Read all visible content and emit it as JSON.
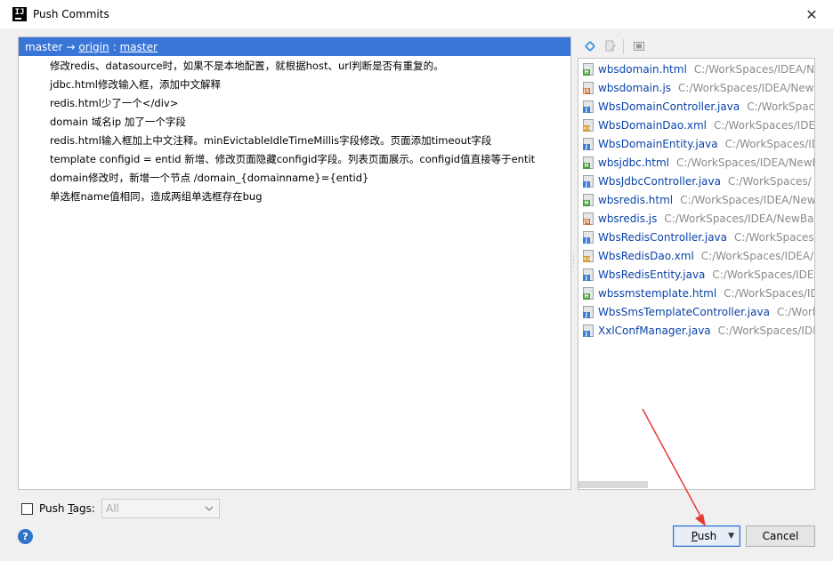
{
  "window": {
    "app_icon": "IJ",
    "title": "Push Commits",
    "close_glyph": "✕"
  },
  "commits": {
    "branch": {
      "local": "master",
      "arrow": "→",
      "remote": "origin",
      "separator": ":",
      "remote_branch": "master"
    },
    "items": [
      "修改redis、datasource时，如果不是本地配置，就根据host、url判断是否有重复的。",
      "jdbc.html修改输入框，添加中文解释",
      "redis.html少了一个</div>",
      "domain  域名ip  加了一个字段",
      "redis.html输入框加上中文注释。minEvictableIdleTimeMillis字段修改。页面添加timeout字段",
      "template    configid = entid    新增、修改页面隐藏configid字段。列表页面展示。configid值直接等于entit",
      "domain修改时，新增一个节点 /domain_{domainname}={entid}",
      "单选框name值相同，造成两组单选框存在bug"
    ]
  },
  "files_toolbar": {
    "icons": [
      "collapse-expand-icon",
      "edit-source-icon",
      "group-by-icon"
    ]
  },
  "files": [
    {
      "name": "wbsdomain.html",
      "path": "C:/WorkSpaces/IDEA/Ne",
      "type": "H",
      "color": "#4a9b3c"
    },
    {
      "name": "wbsdomain.js",
      "path": "C:/WorkSpaces/IDEA/NewB",
      "type": "JS",
      "color": "#d2691e"
    },
    {
      "name": "WbsDomainController.java",
      "path": "C:/WorkSpace",
      "type": "J",
      "color": "#3a7bd5"
    },
    {
      "name": "WbsDomainDao.xml",
      "path": "C:/WorkSpaces/IDEA",
      "type": "<>",
      "color": "#d89b2c"
    },
    {
      "name": "WbsDomainEntity.java",
      "path": "C:/WorkSpaces/ID",
      "type": "J",
      "color": "#3a7bd5"
    },
    {
      "name": "wbsjdbc.html",
      "path": "C:/WorkSpaces/IDEA/NewB",
      "type": "H",
      "color": "#4a9b3c"
    },
    {
      "name": "WbsJdbcController.java",
      "path": "C:/WorkSpaces/",
      "type": "J",
      "color": "#3a7bd5"
    },
    {
      "name": "wbsredis.html",
      "path": "C:/WorkSpaces/IDEA/NewB",
      "type": "H",
      "color": "#4a9b3c"
    },
    {
      "name": "wbsredis.js",
      "path": "C:/WorkSpaces/IDEA/NewBan",
      "type": "JS",
      "color": "#d2691e"
    },
    {
      "name": "WbsRedisController.java",
      "path": "C:/WorkSpaces/",
      "type": "J",
      "color": "#3a7bd5"
    },
    {
      "name": "WbsRedisDao.xml",
      "path": "C:/WorkSpaces/IDEA/N",
      "type": "<>",
      "color": "#d89b2c"
    },
    {
      "name": "WbsRedisEntity.java",
      "path": "C:/WorkSpaces/IDEA",
      "type": "J",
      "color": "#3a7bd5"
    },
    {
      "name": "wbssmstemplate.html",
      "path": "C:/WorkSpaces/IDE",
      "type": "H",
      "color": "#4a9b3c"
    },
    {
      "name": "WbsSmsTemplateController.java",
      "path": "C:/Works",
      "type": "J",
      "color": "#3a7bd5"
    },
    {
      "name": "XxlConfManager.java",
      "path": "C:/WorkSpaces/IDE",
      "type": "J",
      "color": "#3a7bd5"
    }
  ],
  "push_tags": {
    "label_pre": "Push ",
    "label_mnemonic": "T",
    "label_post": "ags:",
    "checked": false,
    "select_value": "All"
  },
  "buttons": {
    "help": "?",
    "push_mnemonic": "P",
    "push_rest": "ush",
    "push_arrow": "▼",
    "cancel": "Cancel"
  },
  "colors": {
    "selection": "#3875d7",
    "annotation_arrow": "#e8382f"
  }
}
